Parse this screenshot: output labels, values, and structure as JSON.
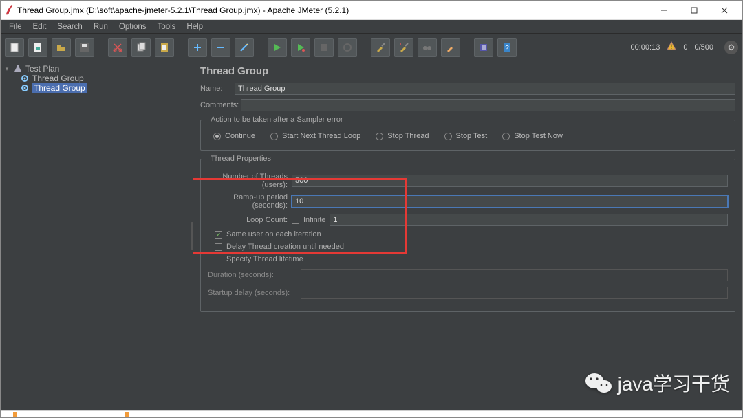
{
  "window": {
    "title": "Thread Group.jmx (D:\\soft\\apache-jmeter-5.2.1\\Thread Group.jmx) - Apache JMeter (5.2.1)"
  },
  "menu": {
    "file": "File",
    "edit": "Edit",
    "search": "Search",
    "run": "Run",
    "options": "Options",
    "tools": "Tools",
    "help": "Help"
  },
  "toolbar_status": {
    "elapsed": "00:00:13",
    "warnings": "0",
    "threads": "0/500"
  },
  "tree": {
    "root": "Test Plan",
    "item1": "Thread Group",
    "item2": "Thread Group"
  },
  "panel": {
    "title": "Thread Group",
    "name_label": "Name:",
    "name_value": "Thread Group",
    "comments_label": "Comments:",
    "comments_value": "",
    "action_legend": "Action to be taken after a Sampler error",
    "radio_continue": "Continue",
    "radio_startnext": "Start Next Thread Loop",
    "radio_stopthread": "Stop Thread",
    "radio_stoptest": "Stop Test",
    "radio_stopnow": "Stop Test Now",
    "tp_legend": "Thread Properties",
    "threads_label": "Number of Threads (users):",
    "threads_value": "500",
    "ramp_label": "Ramp-up period (seconds):",
    "ramp_value": "10",
    "loop_label": "Loop Count:",
    "loop_infinite": "Infinite",
    "loop_value": "1",
    "sameuser": "Same user on each iteration",
    "delaycreate": "Delay Thread creation until needed",
    "lifetime": "Specify Thread lifetime",
    "duration_label": "Duration (seconds):",
    "startup_label": "Startup delay (seconds):"
  },
  "watermark": {
    "text": "java学习干货"
  }
}
